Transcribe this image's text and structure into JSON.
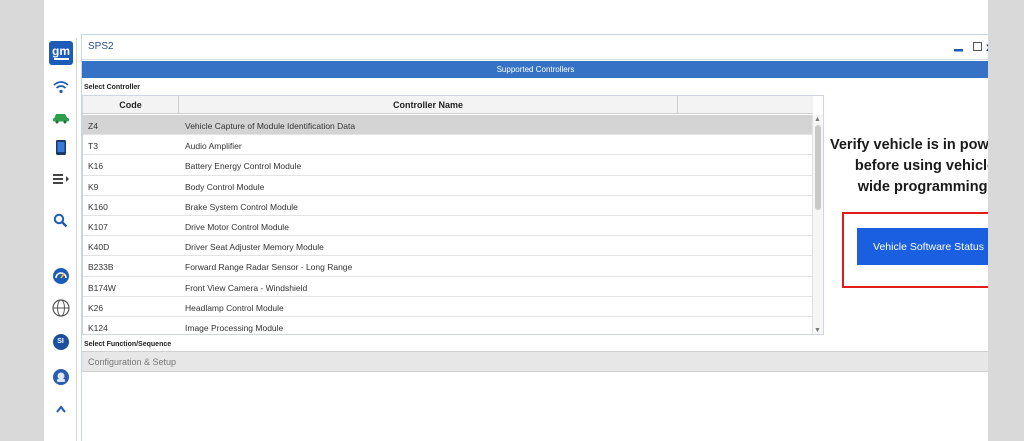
{
  "window": {
    "title": "SPS2",
    "minimize_label": "▁",
    "maximize_label": "☐",
    "close_label": "x"
  },
  "sidebar": {
    "logo_text": "gm",
    "items": [
      {
        "icon": "wifi-icon"
      },
      {
        "icon": "vehicle-icon"
      },
      {
        "icon": "device-icon"
      },
      {
        "icon": "list-menu-icon"
      },
      {
        "icon": "search-icon"
      },
      {
        "icon": "gauge-icon"
      },
      {
        "icon": "globe-icon"
      },
      {
        "icon": "si-icon",
        "label": "SI"
      },
      {
        "icon": "settings-icon"
      }
    ]
  },
  "supported_header": "Supported Controllers",
  "select_controller_label": "Select Controller",
  "table": {
    "columns": [
      "Code",
      "Controller Name"
    ],
    "rows": [
      {
        "code": "Z4",
        "name": "Vehicle Capture of Module Identification Data",
        "selected": true
      },
      {
        "code": "T3",
        "name": "Audio Amplifier"
      },
      {
        "code": "K16",
        "name": "Battery Energy Control Module"
      },
      {
        "code": "K9",
        "name": "Body Control Module"
      },
      {
        "code": "K160",
        "name": "Brake System Control Module"
      },
      {
        "code": "K107",
        "name": "Drive Motor Control Module"
      },
      {
        "code": "K40D",
        "name": "Driver Seat Adjuster Memory Module"
      },
      {
        "code": "B233B",
        "name": "Forward Range Radar Sensor - Long Range"
      },
      {
        "code": "B174W",
        "name": "Front View Camera - Windshield"
      },
      {
        "code": "K26",
        "name": "Headlamp Control Module"
      },
      {
        "code": "K124",
        "name": "Image Processing Module"
      }
    ]
  },
  "select_function_label": "Select Function/Sequence",
  "function_item": "Configuration & Setup",
  "warning_lines": [
    "Verify vehicle is in power off mod",
    "before using vehicle",
    "wide programming!"
  ],
  "vehicle_software_status_button": "Vehicle Software Status",
  "colors": {
    "accent": "#3572c6",
    "button": "#1a5fe0",
    "highlight_box": "#e11b1b"
  }
}
